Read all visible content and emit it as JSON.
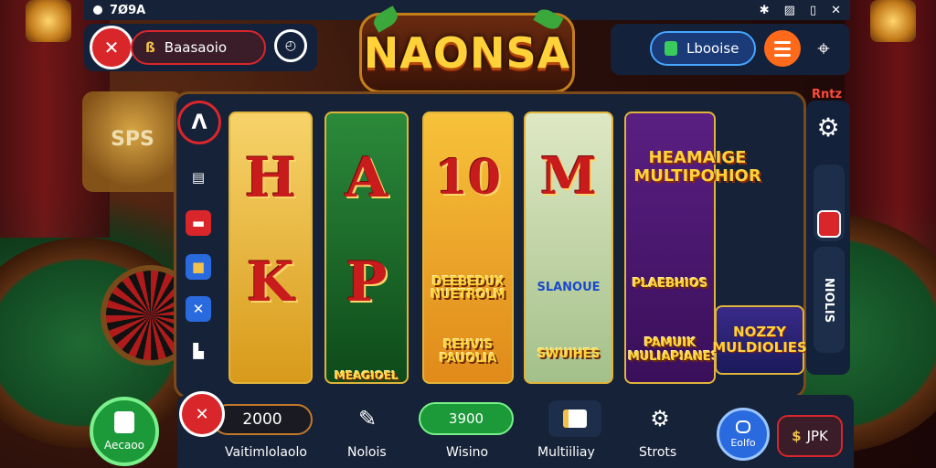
{
  "status_bar": {
    "time": "7Ø9A",
    "icons": [
      "bluetooth-icon",
      "signal-icon",
      "battery-icon",
      "close-icon"
    ]
  },
  "top_left": {
    "close_label": "✕",
    "player_name": "Baasaoio",
    "player_icon": "ß"
  },
  "logo": {
    "title": "NAONSA"
  },
  "top_right": {
    "lobby_label": "Lbooise"
  },
  "left_rail": {
    "top_label": "Λ",
    "icons": [
      "slots-icon",
      "card-icon",
      "chest-icon",
      "cross-icon",
      "flag-icon"
    ]
  },
  "reels": {
    "r1": {
      "top": "H",
      "bottom": "K"
    },
    "r2": {
      "top": "A",
      "bottom": "P"
    },
    "r3": {
      "top": "10",
      "symbol": "DEEBEDUX NUETROLM"
    },
    "r4": {
      "top": "M",
      "symbol": "SLANOUE",
      "bottom": "SWUIHES"
    },
    "r5": {
      "title": "HEAMAIGE MULTIPOHIOR",
      "symbol": "PLAEBHIOS",
      "bottom": "PAMUIK MULIAPIANES"
    },
    "r2_bottom": "MEAGIOEL",
    "r3_bottom": "REHVIS PAUOLIA",
    "nozzy": "NOZZY MULDIOLIES"
  },
  "right_rail": {
    "auto_label": "Rntz",
    "vertical_text": "NIOLIS",
    "slider_level": 0.35
  },
  "bottom_bar": {
    "green_button_label": "Aecaoo",
    "bet_value": "2000",
    "bet_label": "Vaitimlolaolo",
    "notes_label": "Nolois",
    "win_value": "3900",
    "win_label": "Wisino",
    "multiplier_label": "Multiiliay",
    "slots_label": "Strots",
    "blue_button_label": "Eolfo",
    "jackpot_label": "JPK",
    "jackpot_icon": "$"
  }
}
